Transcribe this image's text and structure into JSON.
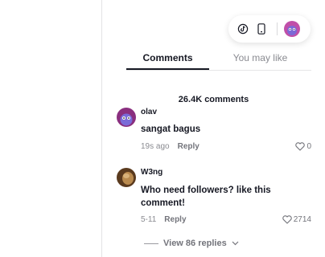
{
  "topbar": {
    "icons": [
      "tiktok-logo-icon",
      "phone-icon",
      "user-avatar"
    ]
  },
  "tabs": [
    {
      "label": "Comments",
      "active": true
    },
    {
      "label": "You may like",
      "active": false
    }
  ],
  "comment_count": "26.4K comments",
  "comments": [
    {
      "username": "olav",
      "text": "sangat bagus",
      "time": "19s ago",
      "reply_label": "Reply",
      "likes": "0"
    },
    {
      "username": "W3ng",
      "text": "Who need followers? like this comment!",
      "time": "5-11",
      "reply_label": "Reply",
      "likes": "2714",
      "view_replies": "View 86 replies"
    }
  ],
  "colors": {
    "text_primary": "#161823",
    "text_secondary": "#8a8b91",
    "avatar_purple": "#7a3fb3"
  }
}
